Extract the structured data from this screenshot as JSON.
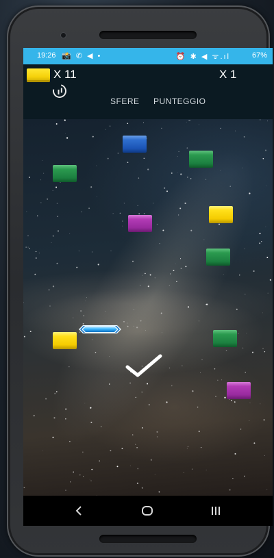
{
  "status_bar": {
    "time": "19:26",
    "left_icons": "📸 ✆ ◀ •",
    "right_icons": "⏰ ✱ ◀ ᯤ.ıl",
    "battery": "67%"
  },
  "hud": {
    "balls_count": "X 11",
    "score_multiplier": "X 1",
    "balls_label": "SFERE",
    "score_label": "PUNTEGGIO"
  },
  "bricks": [
    {
      "color": "blue"
    },
    {
      "color": "green"
    },
    {
      "color": "green"
    },
    {
      "color": "yellow"
    },
    {
      "color": "purple"
    },
    {
      "color": "green"
    },
    {
      "color": "yellow"
    },
    {
      "color": "green"
    },
    {
      "color": "purple"
    }
  ],
  "icons": {
    "pause": "pause-icon",
    "confirm": "check-icon",
    "nav_back": "back-icon",
    "nav_home": "home-icon",
    "nav_recents": "recents-icon"
  },
  "colors": {
    "status_bar": "#35b5ea",
    "hud_background": "#0b1a22",
    "paddle": "#39b6ff"
  }
}
